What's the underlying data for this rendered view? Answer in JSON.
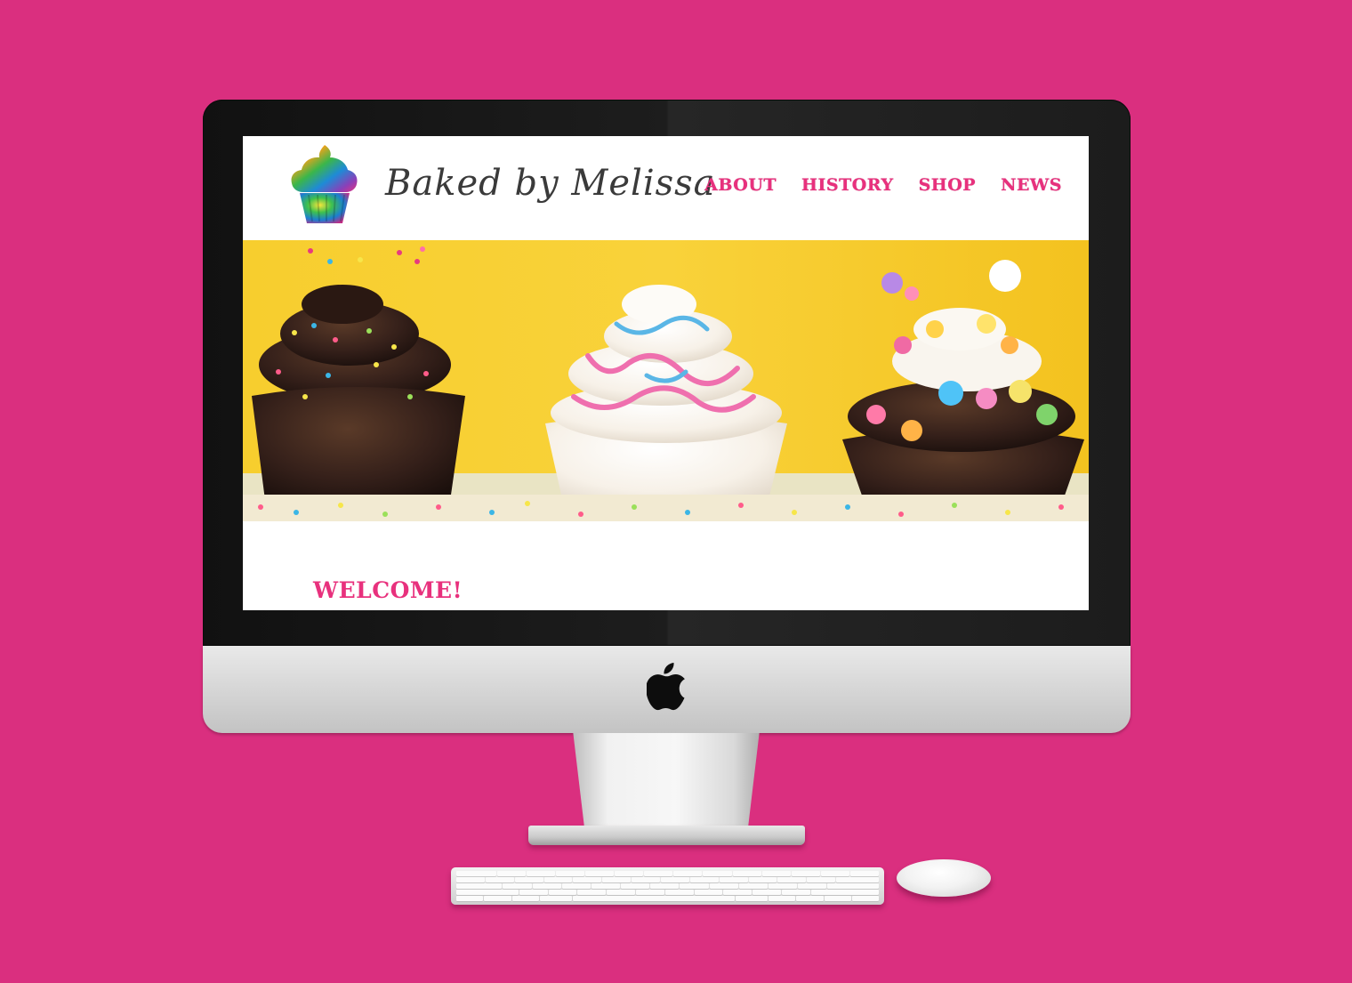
{
  "colors": {
    "background": "#DA2F7F",
    "accent_pink": "#E8317D",
    "hero_yellow": "#F5C62A",
    "chocolate": "#3a2418",
    "frosting": "#f5eee6"
  },
  "site": {
    "brand": "Baked by Melissa",
    "logo_icon": "cupcake-icon",
    "nav": [
      {
        "label": "ABOUT"
      },
      {
        "label": "HISTORY"
      },
      {
        "label": "SHOP"
      },
      {
        "label": "NEWS"
      }
    ],
    "hero_image": "three-cupcakes-with-sprinkles",
    "welcome": "WELCOME!"
  },
  "device": {
    "logo_icon": "apple-logo-icon",
    "peripherals": [
      "keyboard",
      "mouse"
    ]
  }
}
